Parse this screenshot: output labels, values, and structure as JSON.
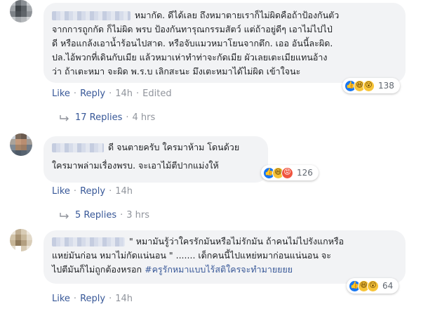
{
  "comments": [
    {
      "text_lines": [
        "หมากัด. ดีได้เลย ถึงหมาตายเราก็ไม่ผิดคือถ้าป้องกันตัว",
        "จากการถูกกัด ก็ไม่ผิด พรบ ป้องกันทารุณกรรมสัตว์ แต่ถ้าอยู่ดีๆ เอาไม่ไปไป่",
        "ดี หรือแกล้งเอาน้ำร้อนไปสาด. หรือจับแมวหมาโยนจากตึก. เออ อันนี้ละผิด.",
        "ปล.ไอ้พวกที่เดินกับเมีย แล้วหมาเห่าทำท่าจะกัดเมีย ผัวเลยเตะเมียแทนอ้าง",
        "ว่า ถ้าเตะหมา จะผิด พ.ร.บ เลิกสะนะ มึงเตะหมาได้ไม่ผิด เข้าใจนะ"
      ],
      "reactions": {
        "icons": [
          "like-icon",
          "haha-icon",
          "wow-icon"
        ],
        "count": "138"
      },
      "actions": {
        "like": "Like",
        "reply": "Reply",
        "time": "14h",
        "edited": "Edited"
      },
      "replies": {
        "label": "17 Replies",
        "time": "4 hrs"
      }
    },
    {
      "text_lines": [
        "ดี จนตายครับ ใครมาห้าม โดนด้วย",
        "ใครมาพล่ามเรื่องพรบ. จะเอาไม้ตีปากแม่งให้"
      ],
      "reactions": {
        "icons": [
          "like-icon",
          "haha-icon",
          "angry-icon"
        ],
        "count": "126"
      },
      "actions": {
        "like": "Like",
        "reply": "Reply",
        "time": "14h"
      },
      "replies": {
        "label": "5 Replies",
        "time": "3 hrs"
      }
    },
    {
      "text_lines": [
        "\" หมามันรู้ว่าใครรักมันหรือไม่รักมัน ถ้าคนไม่ไปรังแกหรือ",
        "แหย่มันก่อน หมาไม่กัดแน่นอน \" ....... เด็กคนนี้ไปแหย่หมาก่อนแน่นอน จะ",
        "ไปตีมันก็ไม่ถูกต้องหรอก "
      ],
      "hashtag": "#ครูรักหมาแบบไร้สติใครจะทำมายยยย",
      "reactions": {
        "icons": [
          "like-icon",
          "haha-icon",
          "wow-icon"
        ],
        "count": "64"
      },
      "actions": {
        "like": "Like",
        "reply": "Reply",
        "time": "14h"
      }
    }
  ],
  "colors": {
    "link": "#385898",
    "meta": "#90949c",
    "bubble": "#f2f3f5",
    "like": "#1877f2",
    "haha_wow": "#f7c439",
    "angry": "#f0553f"
  }
}
